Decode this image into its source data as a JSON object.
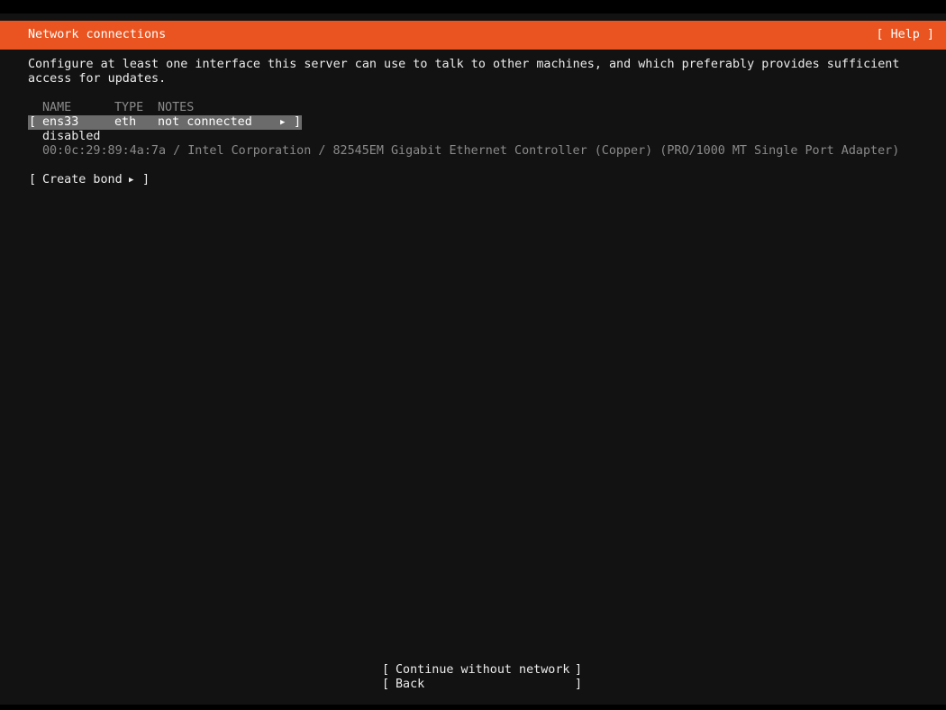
{
  "header": {
    "title": "Network connections",
    "help_label": "[ Help ]"
  },
  "intro": {
    "line1": "Configure at least one interface this server can use to talk to other machines, and which preferably provides sufficient",
    "line2": "access for updates."
  },
  "table": {
    "columns": [
      "NAME",
      "TYPE",
      "NOTES"
    ],
    "interfaces": [
      {
        "bracket_open": "[",
        "name": "ens33",
        "type": "eth",
        "notes": "not connected",
        "arrow": "▶",
        "bracket_close": "]",
        "status": "disabled",
        "hardware": "00:0c:29:89:4a:7a / Intel Corporation / 82545EM Gigabit Ethernet Controller (Copper) (PRO/1000 MT Single Port Adapter)"
      }
    ]
  },
  "create_bond": {
    "bracket_open": "[",
    "label": "Create bond",
    "arrow": "▶",
    "bracket_close": "]"
  },
  "footer": {
    "continue": {
      "bracket_open": "[",
      "label": "Continue without network",
      "bracket_close": "]"
    },
    "back": {
      "bracket_open": "[",
      "label": "Back",
      "bracket_close": "]"
    }
  },
  "colors": {
    "accent": "#e95420",
    "background": "#121212",
    "selected_row": "#6b6b6b",
    "muted_text": "#8a8a8a"
  }
}
